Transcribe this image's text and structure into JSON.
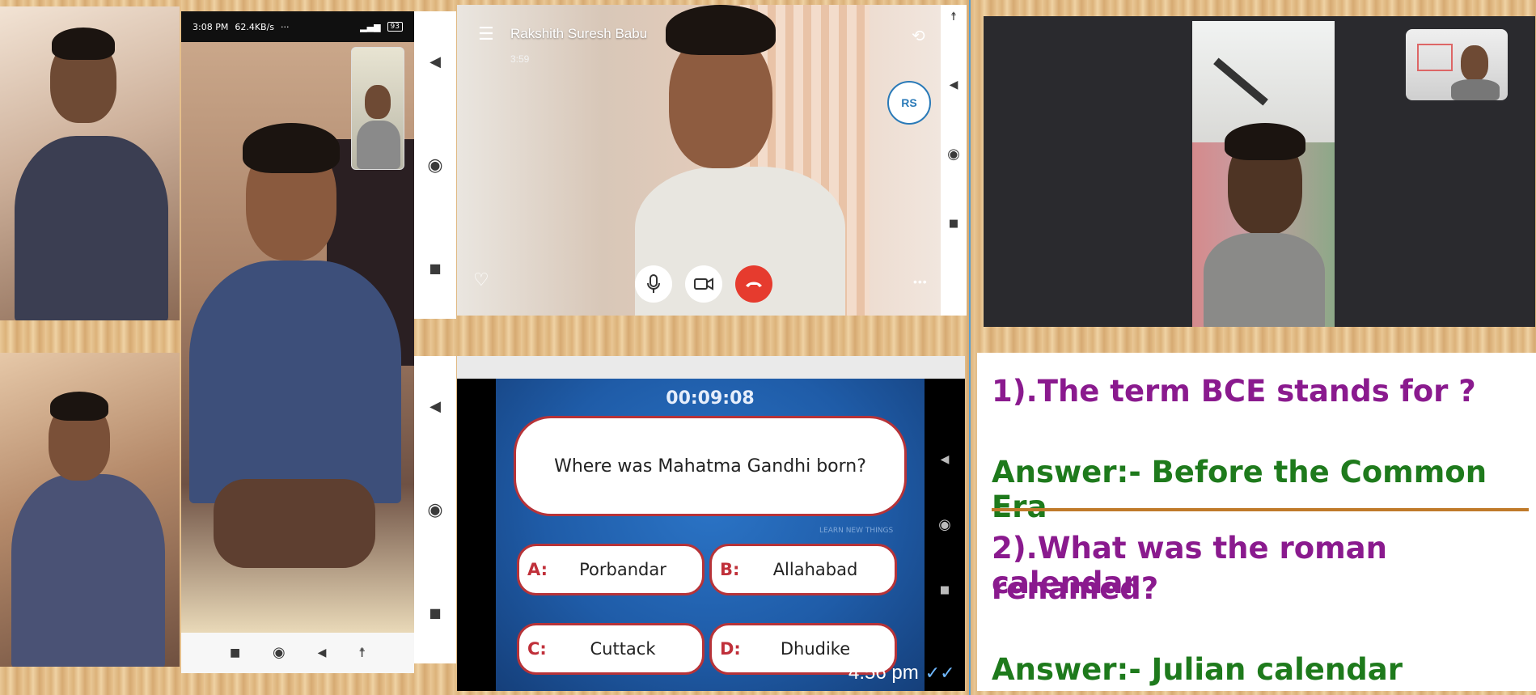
{
  "phone_left": {
    "status_bar": {
      "time": "3:08 PM",
      "speed": "62.4KB/s",
      "dots": "···",
      "battery": "93"
    },
    "nav_icons": [
      "square-icon",
      "circle-icon",
      "back-icon",
      "accessibility-icon"
    ]
  },
  "skype_call": {
    "caller_name": "Rakshith Suresh Babu",
    "duration": "3:59",
    "avatar_initials": "RS",
    "more_label": "•••"
  },
  "quiz": {
    "timer": "00:09:08",
    "question": "Where was Mahatma Gandhi born?",
    "tagline": "LEARN NEW THINGS",
    "options": [
      {
        "letter": "A:",
        "text": "Porbandar"
      },
      {
        "letter": "B:",
        "text": "Allahabad"
      },
      {
        "letter": "C:",
        "text": "Cuttack"
      },
      {
        "letter": "D:",
        "text": "Dhudike"
      }
    ],
    "timestamp": "4:56 pm",
    "read_ticks": "✓✓"
  },
  "qa_panel": {
    "q1": "1).The term BCE stands for ?",
    "a1": "Answer:- Before the Common Era",
    "q2_line1": "2).What was the roman calendar",
    "q2_line2": "renamed?",
    "a2": "Answer:- Julian calendar"
  },
  "colors": {
    "question": "#8a1a8e",
    "answer": "#1e7a1c",
    "divider": "#c07a2a",
    "quiz_bg": "#1f5ca8",
    "end_call": "#e63b2e",
    "avatar_ring": "#2a7ab8"
  }
}
